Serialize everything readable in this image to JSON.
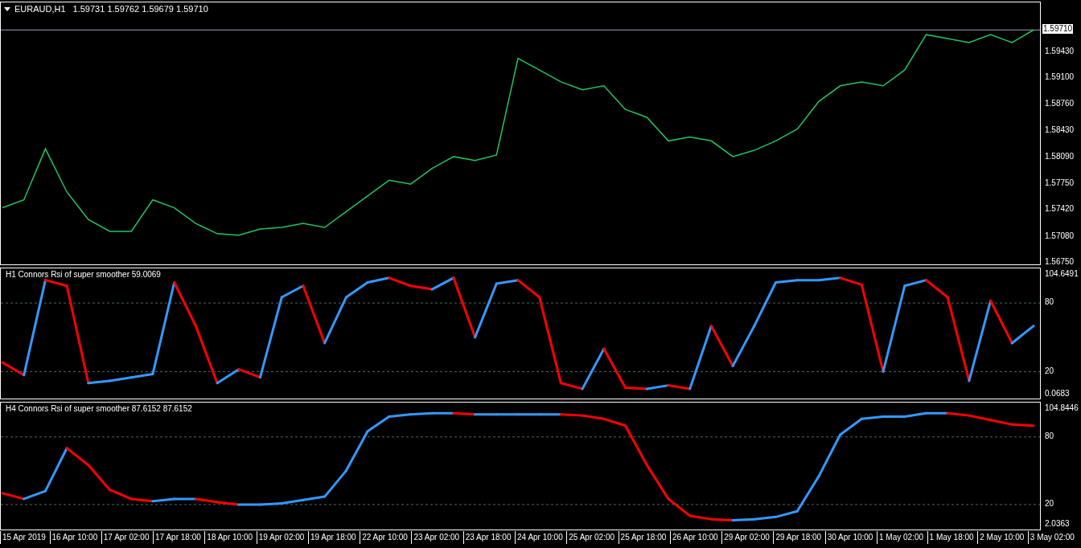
{
  "main_panel": {
    "symbol": "EURAUD,H1",
    "quote": "1.59731 1.59762 1.59679 1.59710",
    "chart_data": {
      "type": "line",
      "ylim": [
        1.5671,
        1.6006
      ],
      "ref_lines": [
        {
          "axis": "y",
          "value": 1.5971,
          "label": "1.59710"
        }
      ],
      "yticks": [
        {
          "value": 1.5943,
          "label": "1.59430"
        },
        {
          "value": 1.591,
          "label": "1.59100"
        },
        {
          "value": 1.5876,
          "label": "1.58760"
        },
        {
          "value": 1.5843,
          "label": "1.58430"
        },
        {
          "value": 1.5809,
          "label": "1.58090"
        },
        {
          "value": 1.5775,
          "label": "1.57750"
        },
        {
          "value": 1.5742,
          "label": "1.57420"
        },
        {
          "value": 1.5708,
          "label": "1.57080"
        },
        {
          "value": 1.5675,
          "label": "1.56750"
        }
      ],
      "series": [
        {
          "color": "#22c55e",
          "values": [
            1.5745,
            1.5755,
            1.582,
            1.5765,
            1.573,
            1.5715,
            1.5715,
            1.5755,
            1.5745,
            1.5725,
            1.5712,
            1.571,
            1.5718,
            1.572,
            1.5725,
            1.572,
            1.574,
            1.576,
            1.578,
            1.5775,
            1.5795,
            1.581,
            1.5805,
            1.5812,
            1.5935,
            1.592,
            1.5905,
            1.5895,
            1.59,
            1.587,
            1.586,
            1.583,
            1.5835,
            1.583,
            1.581,
            1.5818,
            1.583,
            1.5845,
            1.588,
            1.59,
            1.5905,
            1.59,
            1.592,
            1.5965,
            1.596,
            1.5955,
            1.5965,
            1.5955,
            1.5971
          ]
        }
      ]
    }
  },
  "indicator_panels": [
    {
      "title": "H1 Connors Rsi of super smoother 59.0069",
      "chart_data": {
        "type": "line",
        "ylim": [
          -4.9,
          110.3
        ],
        "yticks": [
          {
            "value": 104.6491,
            "label": "104.6491"
          },
          {
            "value": 80,
            "label": "80"
          },
          {
            "value": 20,
            "label": "20"
          },
          {
            "value": 0.0683,
            "label": "0.0683"
          }
        ],
        "series": [
          {
            "color": "#3399ff",
            "values": [
              null,
              17,
              100,
              null,
              10,
              12,
              15,
              18,
              98,
              null,
              10,
              22,
              15,
              85,
              95,
              45,
              85,
              98,
              102,
              null,
              92,
              102,
              50,
              97,
              100,
              null,
              null,
              5,
              40,
              null,
              5,
              8,
              5,
              60,
              25,
              60,
              98,
              100,
              100,
              102,
              null,
              20,
              95,
              100,
              null,
              12,
              82,
              45,
              60
            ]
          },
          {
            "color": "#ff0000",
            "values": [
              28,
              17,
              100,
              95,
              10,
              null,
              null,
              null,
              98,
              60,
              10,
              22,
              15,
              null,
              95,
              45,
              null,
              null,
              102,
              95,
              92,
              102,
              50,
              null,
              100,
              85,
              10,
              5,
              40,
              6,
              5,
              8,
              5,
              60,
              25,
              null,
              null,
              null,
              null,
              102,
              96,
              20,
              null,
              100,
              85,
              12,
              82,
              45,
              null
            ]
          }
        ]
      }
    },
    {
      "title": "H4 Connors Rsi of super smoother 87.6152 87.6152",
      "chart_data": {
        "type": "line",
        "ylim": [
          -3.6,
          110.5
        ],
        "yticks": [
          {
            "value": 104.8446,
            "label": "104.8446"
          },
          {
            "value": 80,
            "label": "80"
          },
          {
            "value": 20,
            "label": "20"
          },
          {
            "value": 2.0363,
            "label": "2.0363"
          }
        ],
        "series": [
          {
            "color": "#3399ff",
            "values": [
              null,
              25,
              32,
              70,
              null,
              null,
              null,
              23,
              25,
              25,
              null,
              20,
              20,
              21,
              24,
              27,
              50,
              85,
              98,
              100,
              101,
              101,
              100,
              100,
              100,
              100,
              100,
              null,
              null,
              null,
              null,
              null,
              null,
              null,
              6,
              7,
              9,
              14,
              45,
              82,
              96,
              98,
              98,
              101,
              101,
              null,
              null,
              null,
              null
            ]
          },
          {
            "color": "#ff0000",
            "values": [
              30,
              25,
              null,
              70,
              55,
              33,
              25,
              23,
              null,
              25,
              22,
              20,
              null,
              null,
              null,
              null,
              null,
              null,
              null,
              null,
              null,
              101,
              100,
              null,
              null,
              null,
              100,
              99,
              96,
              90,
              55,
              25,
              10,
              7,
              6,
              null,
              null,
              null,
              null,
              null,
              null,
              null,
              null,
              null,
              101,
              99,
              95,
              91,
              90
            ]
          }
        ]
      }
    }
  ],
  "time_axis": {
    "labels": [
      "15 Apr 2019",
      "16 Apr 10:00",
      "17 Apr 02:00",
      "17 Apr 18:00",
      "18 Apr 10:00",
      "19 Apr 02:00",
      "19 Apr 18:00",
      "22 Apr 10:00",
      "23 Apr 02:00",
      "23 Apr 18:00",
      "24 Apr 10:00",
      "25 Apr 02:00",
      "25 Apr 18:00",
      "26 Apr 10:00",
      "29 Apr 02:00",
      "29 Apr 18:00",
      "30 Apr 10:00",
      "1 May 02:00",
      "1 May 18:00",
      "2 May 10:00",
      "3 May 02:00"
    ]
  }
}
